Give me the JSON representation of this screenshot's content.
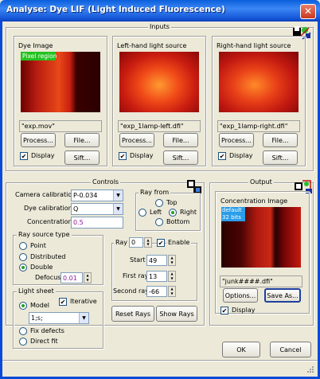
{
  "window": {
    "title": "Analyse: Dye LIF (Light Induced Fluorescence)",
    "close_glyph": "✕"
  },
  "inputs": {
    "title": "Inputs",
    "dye": {
      "title": "Dye Image",
      "overlay": "Pixel region",
      "file": "\"exp.mov\"",
      "process": "Process...",
      "file_btn": "File...",
      "display": "Display",
      "sift": "Sift..."
    },
    "left": {
      "title": "Left-hand light source",
      "file": "\"exp_1lamp-left.dfi\"",
      "process": "Process...",
      "file_btn": "File...",
      "display": "Display",
      "sift": "Sift..."
    },
    "right": {
      "title": "Right-hand light source",
      "file": "\"exp_1lamp-right.dfi\"",
      "process": "Process...",
      "file_btn": "File...",
      "display": "Display",
      "sift": "Sift..."
    }
  },
  "controls": {
    "title": "Controls",
    "camera_label": "Camera calibration",
    "camera_value": "P-0.034",
    "dye_label": "Dye calibration",
    "dye_value": "Q",
    "conc_label": "Concentration",
    "conc_value": "0.5",
    "ray_from": {
      "title": "Ray from",
      "top": "Top",
      "left": "Left",
      "right": "Right",
      "bottom": "Bottom"
    },
    "ray_source": {
      "title": "Ray source type",
      "point": "Point",
      "distributed": "Distributed",
      "double": "Double",
      "defocus_label": "Defocus",
      "defocus_value": "0.01"
    },
    "light_sheet": {
      "title": "Light sheet",
      "model": "Model",
      "iterative": "Iterative",
      "model_value": "1;s;",
      "fix": "Fix defects",
      "direct": "Direct fit"
    },
    "ray": {
      "label": "Ray",
      "value": "0",
      "enable": "Enable",
      "start_label": "Start",
      "start_value": "49",
      "first_label": "First ray",
      "first_value": "13",
      "second_label": "Second ray",
      "second_value": "-66"
    },
    "reset": "Reset Rays",
    "show": "Show Rays"
  },
  "output": {
    "title": "Output",
    "image_title": "Concentration Image",
    "overlay1": "default",
    "overlay2": "32 bits",
    "file": "\"junk####.dfi\"",
    "options": "Options...",
    "save": "Save As...",
    "display": "Display"
  },
  "buttons": {
    "ok": "OK",
    "cancel": "Cancel"
  },
  "colors": {
    "title_bar": "#0a5fdc",
    "dialog_bg": "#ece9d8",
    "overlay_green": "#22c21e",
    "overlay_cyan": "#2a9de8"
  }
}
